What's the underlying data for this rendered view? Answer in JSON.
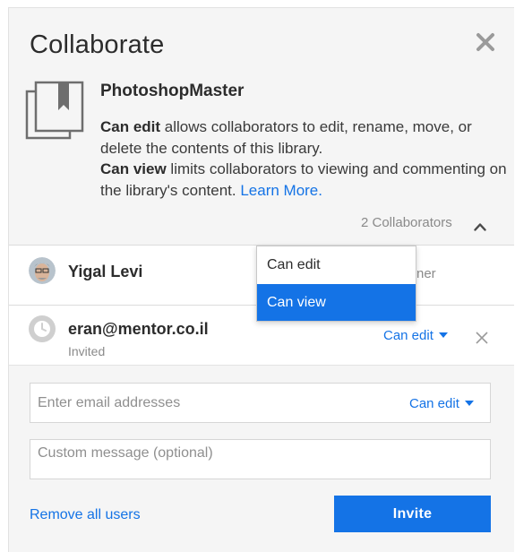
{
  "dialog": {
    "title": "Collaborate",
    "library_name": "PhotoshopMaster",
    "desc_can_edit_bold": "Can edit",
    "desc_can_edit_rest": " allows collaborators to edit, rename, move, or delete the contents of this library.",
    "desc_can_view_bold": "Can view",
    "desc_can_view_rest": " limits collaborators to viewing and commenting on the library's content. ",
    "learn_more": "Learn More.",
    "collaborators_count": "2 Collaborators"
  },
  "collaborators": [
    {
      "name": "Yigal Levi",
      "role_partial": "ner"
    },
    {
      "email": "eran@mentor.co.il",
      "status": "Invited",
      "permission": "Can edit"
    }
  ],
  "dropdown": {
    "options": [
      "Can edit",
      "Can view"
    ],
    "highlighted": "Can view"
  },
  "invite_form": {
    "email_placeholder": "Enter email addresses",
    "email_permission": "Can edit",
    "message_placeholder": "Custom message (optional)",
    "remove_all_label": "Remove all users",
    "invite_label": "Invite"
  },
  "colors": {
    "accent": "#1473e6",
    "panel_bg": "#f5f5f5",
    "muted_text": "#8a8a8a"
  },
  "icons": {
    "close": "close-icon",
    "library": "library-icon",
    "chevron_up": "chevron-up-icon",
    "clock": "clock-icon",
    "caret_down": "caret-down-icon",
    "remove": "remove-x-icon"
  }
}
